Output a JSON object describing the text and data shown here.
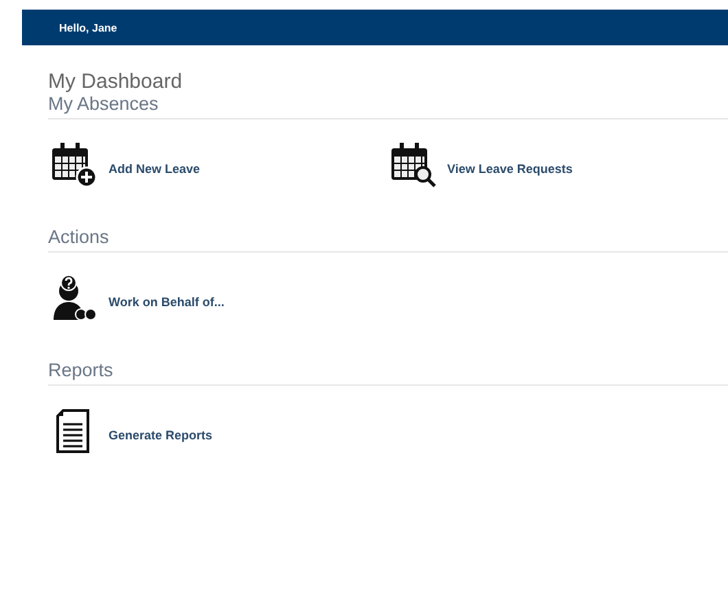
{
  "header": {
    "greeting": "Hello, Jane"
  },
  "title": "My Dashboard",
  "sections": [
    {
      "heading": "My Absences",
      "items": [
        {
          "kind": "calendar-add",
          "label": "Add New Leave"
        },
        {
          "kind": "calendar-search",
          "label": "View Leave Requests"
        }
      ]
    },
    {
      "heading": "Actions",
      "items": [
        {
          "kind": "person-help",
          "label": "Work on Behalf of..."
        }
      ]
    },
    {
      "heading": "Reports",
      "items": [
        {
          "kind": "document",
          "label": "Generate Reports"
        }
      ]
    }
  ]
}
